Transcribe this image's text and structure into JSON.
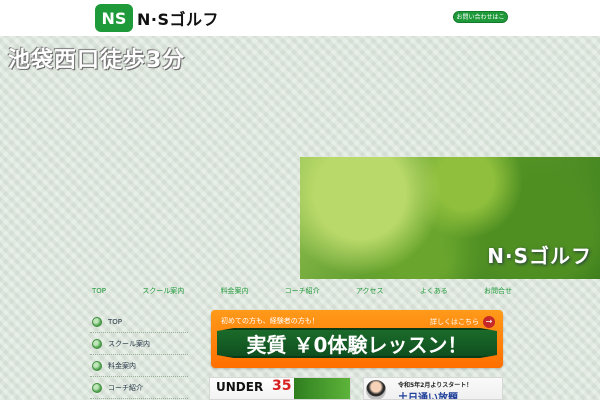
{
  "header": {
    "logo_mark": "NS",
    "logo_text": "N·Sゴルフ",
    "top_button_label": "お問い合わせはこちら"
  },
  "hero": {
    "headline": "池袋西口徒歩3分",
    "image_title": "N·Sゴルフ"
  },
  "topnav": {
    "items": [
      "TOP",
      "スクール案内",
      "料金案内",
      "コーチ紹介",
      "アクセス",
      "よくある",
      "お問合せ"
    ]
  },
  "sidemenu": {
    "items": [
      "TOP",
      "スクール案内",
      "料金案内",
      "コーチ紹介"
    ]
  },
  "trial_banner": {
    "subtitle": "初めての方も、経験者の方も！",
    "link_label": "詳しくはこちら",
    "arrow": "→",
    "main_text": "実質 ￥0体験レッスン！"
  },
  "banners": {
    "left": {
      "prefix": "UNDER",
      "number": "35"
    },
    "right": {
      "top": "令和5年2月よりスタート！",
      "bottom": "土日通い放題"
    }
  },
  "colors": {
    "brand_green": "#1f9a3a",
    "orange": "#ff7f00",
    "ribbon_green": "#1b6b2a",
    "page_bg": "#dfe9df"
  }
}
